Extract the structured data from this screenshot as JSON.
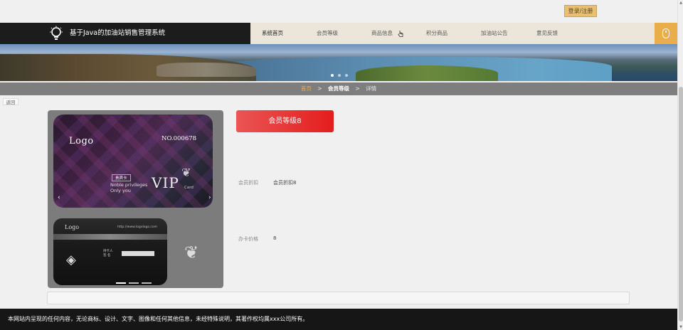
{
  "top": {
    "login_label": "登录/注册"
  },
  "header": {
    "site_title": "基于Java的加油站销售管理系统",
    "nav": [
      {
        "label": "系统首页",
        "active": true
      },
      {
        "label": "会员等级",
        "active": false
      },
      {
        "label": "商品信息",
        "active": false
      },
      {
        "label": "积分商品",
        "active": false
      },
      {
        "label": "加油站公告",
        "active": false
      },
      {
        "label": "意见反馈",
        "active": false
      }
    ]
  },
  "breadcrumb": {
    "home": "首页",
    "section": "会员等级",
    "current": "详情",
    "separator": ">"
  },
  "back_label": "返回",
  "gallery": {
    "card_logo": "Logo",
    "card_number": "NO.000678",
    "card_tag": "贵宾卡",
    "card_slogan_1": "Noble privileges",
    "card_slogan_2": "Only you",
    "card_vip": "VIP",
    "card_word": "Card",
    "back_logo": "Logo",
    "back_url": "http://www.logologo.com",
    "holder_1": "持卡人",
    "holder_2": "签  名"
  },
  "detail": {
    "level_name": "会员等级8",
    "discount_label": "会员折扣",
    "discount_value": "会员折扣8",
    "price_label": "办卡价格",
    "price_value": "8"
  },
  "footer": {
    "text": "本网站内呈现的任何内容，无论商标、设计、文字、图像和任何其他信息，未经特殊说明，其著作权均属xxx公司所有。"
  },
  "colors": {
    "accent": "#e9ad4c",
    "level_button": "#e41d1d",
    "header_dark": "#1c1c1c",
    "nav_bg": "#ece6da"
  }
}
